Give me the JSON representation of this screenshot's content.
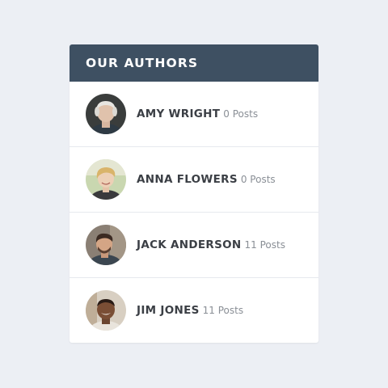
{
  "widget": {
    "title": "OUR AUTHORS",
    "header_color": "#3e5062"
  },
  "authors": [
    {
      "name": "AMY WRIGHT",
      "posts": "0 Posts",
      "avatar": "avatar-photo-amy"
    },
    {
      "name": "ANNA FLOWERS",
      "posts": "0 Posts",
      "avatar": "avatar-photo-anna"
    },
    {
      "name": "JACK ANDERSON",
      "posts": "11 Posts",
      "avatar": "avatar-photo-jack"
    },
    {
      "name": "JIM JONES",
      "posts": "11 Posts",
      "avatar": "avatar-photo-jim"
    }
  ]
}
